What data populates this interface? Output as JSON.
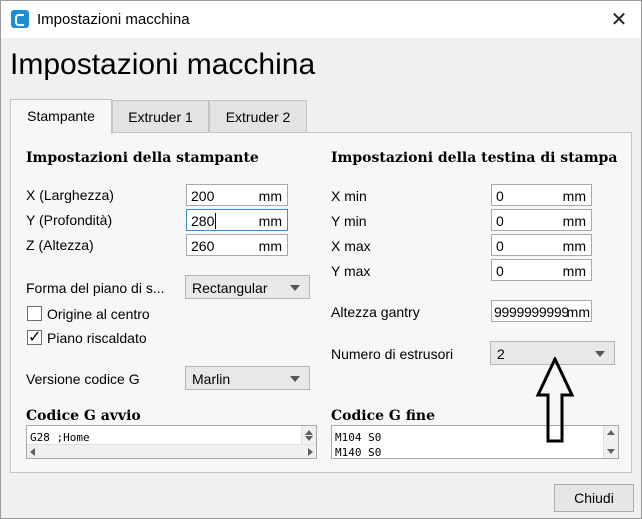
{
  "window": {
    "title": "Impostazioni macchina",
    "icon": "cura-icon",
    "close_glyph": "✕"
  },
  "heading": "Impostazioni macchina",
  "tabs": [
    {
      "label": "Stampante",
      "active": true
    },
    {
      "label": "Extruder 1",
      "active": false
    },
    {
      "label": "Extruder 2",
      "active": false
    }
  ],
  "printer_settings": {
    "title": "Impostazioni della stampante",
    "fields": [
      {
        "label": "X (Larghezza)",
        "value": "200",
        "unit": "mm"
      },
      {
        "label": "Y (Profondità)",
        "value": "280",
        "unit": "mm"
      },
      {
        "label": "Z (Altezza)",
        "value": "260",
        "unit": "mm"
      }
    ],
    "bed_shape": {
      "label": "Forma del piano di s...",
      "value": "Rectangular"
    },
    "origin_center": {
      "label": "Origine al centro",
      "checked": false,
      "mark": ""
    },
    "heated_bed": {
      "label": "Piano riscaldato",
      "checked": true,
      "mark": "✓"
    },
    "gcode_flavor": {
      "label": "Versione codice G",
      "value": "Marlin"
    }
  },
  "head_settings": {
    "title": "Impostazioni della testina di stampa",
    "fields": [
      {
        "label": "X min",
        "value": "0",
        "unit": "mm"
      },
      {
        "label": "Y min",
        "value": "0",
        "unit": "mm"
      },
      {
        "label": "X max",
        "value": "0",
        "unit": "mm"
      },
      {
        "label": "Y max",
        "value": "0",
        "unit": "mm"
      }
    ],
    "gantry_height": {
      "label": "Altezza gantry",
      "value": "9999999999",
      "unit": "mm"
    },
    "extruder_count": {
      "label": "Numero di estrusori",
      "value": "2"
    }
  },
  "start_gcode": {
    "title": "Codice G avvio",
    "lines": [
      "G28 ;Home"
    ]
  },
  "end_gcode": {
    "title": "Codice G fine",
    "lines": [
      "M104 S0",
      "M140 S0"
    ]
  },
  "close_button": "Chiudi",
  "colors": {
    "accent": "#1a8fd6",
    "focus_border": "#3c8ad8"
  }
}
